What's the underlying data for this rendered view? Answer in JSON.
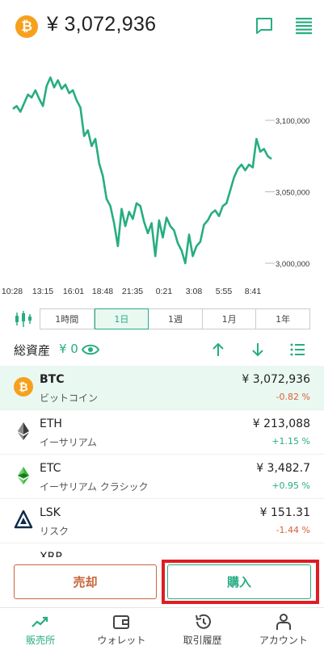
{
  "header": {
    "coin_symbol_icon": "bitcoin-icon",
    "coin_symbol_glyph": "₿",
    "price": "¥ 3,072,936",
    "icons": [
      "chat-icon",
      "menu-icon"
    ]
  },
  "chart": {
    "y_ticks": [
      "3,100,000",
      "3,050,000",
      "3,000,000"
    ],
    "x_ticks": [
      "10:28",
      "13:15",
      "16:01",
      "18:48",
      "21:35",
      "0:21",
      "3:08",
      "5:55",
      "8:41"
    ],
    "line_color": "#27ad82",
    "series": [
      3108000,
      3110000,
      3106000,
      3112000,
      3118000,
      3116000,
      3121000,
      3115000,
      3110000,
      3124000,
      3130000,
      3123000,
      3128000,
      3122000,
      3125000,
      3119000,
      3121000,
      3114000,
      3109000,
      3089000,
      3093000,
      3082000,
      3087000,
      3070000,
      3061000,
      3045000,
      3040000,
      3028000,
      3012000,
      3038000,
      3026000,
      3036000,
      3031000,
      3042000,
      3040000,
      3029000,
      3021000,
      3028000,
      3005000,
      3030000,
      3018000,
      3032000,
      3026000,
      3023000,
      3014000,
      3009000,
      3000000,
      3020000,
      3005000,
      3012000,
      3015000,
      3027000,
      3030000,
      3035000,
      3037000,
      3033000,
      3040000,
      3042000,
      3051000,
      3060000,
      3066000,
      3069000,
      3065000,
      3069000,
      3067000,
      3087000,
      3078000,
      3080000,
      3075000,
      3072936
    ]
  },
  "range": {
    "tabs": [
      {
        "label": "1時間",
        "active": false
      },
      {
        "label": "1日",
        "active": true
      },
      {
        "label": "1週",
        "active": false
      },
      {
        "label": "1月",
        "active": false
      },
      {
        "label": "1年",
        "active": false
      }
    ]
  },
  "assets": {
    "label": "総資産",
    "value": "¥ 0"
  },
  "coins": [
    {
      "symbol": "BTC",
      "name": "ビットコイン",
      "price": "¥ 3,072,936",
      "change": "-0.82 %",
      "direction": "down",
      "icon": "bitcoin-icon"
    },
    {
      "symbol": "ETH",
      "name": "イーサリアム",
      "price": "¥ 213,088",
      "change": "+1.15 %",
      "direction": "up",
      "icon": "ethereum-icon"
    },
    {
      "symbol": "ETC",
      "name": "イーサリアム クラシック",
      "price": "¥ 3,482.7",
      "change": "+0.95 %",
      "direction": "up",
      "icon": "ethereum-classic-icon"
    },
    {
      "symbol": "LSK",
      "name": "リスク",
      "price": "¥ 151.31",
      "change": "-1.44 %",
      "direction": "down",
      "icon": "lisk-icon"
    },
    {
      "symbol": "XRP",
      "name": "",
      "price": "",
      "change": "",
      "direction": "",
      "icon": ""
    }
  ],
  "actions": {
    "sell_label": "売却",
    "buy_label": "購入"
  },
  "nav": [
    {
      "label": "販売所",
      "icon": "trend-icon",
      "active": true
    },
    {
      "label": "ウォレット",
      "icon": "wallet-icon",
      "active": false
    },
    {
      "label": "取引履歴",
      "icon": "history-icon",
      "active": false
    },
    {
      "label": "アカウント",
      "icon": "account-icon",
      "active": false
    }
  ]
}
